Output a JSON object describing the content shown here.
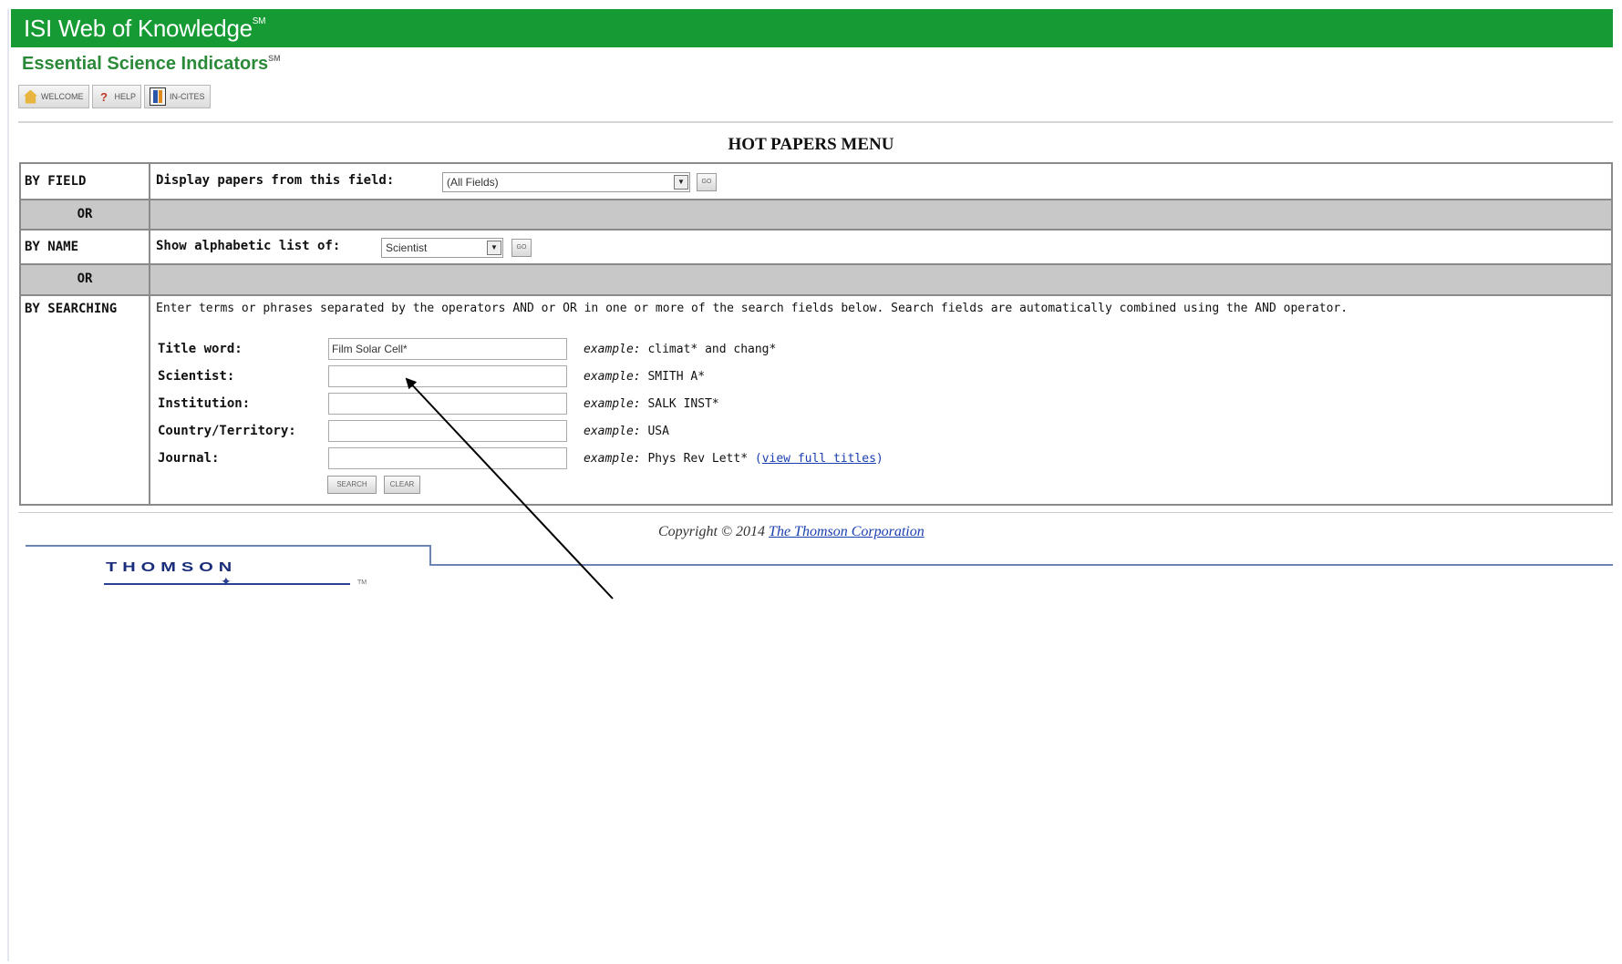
{
  "header": {
    "brand": "ISI Web of Knowledge",
    "brand_mark": "SM",
    "subtitle": "Essential Science Indicators",
    "subtitle_mark": "SM",
    "brand_color": "#159a34"
  },
  "toolbar": {
    "welcome": "WELCOME",
    "help": "HELP",
    "incites": "IN-CITES"
  },
  "menu_title": "HOT PAPERS MENU",
  "by_field": {
    "label": "BY FIELD",
    "prompt": "Display papers from this field:",
    "select_value": "(All Fields)",
    "go": "GO"
  },
  "or_label": "OR",
  "by_name": {
    "label": "BY NAME",
    "prompt": "Show alphabetic list of:",
    "select_value": "Scientist",
    "go": "GO"
  },
  "by_searching": {
    "label": "BY SEARCHING",
    "instructions": "Enter terms or phrases separated by the operators AND or OR in one or more of the search fields below. Search fields are automatically combined using the AND operator.",
    "example_prefix": "example:",
    "fields": [
      {
        "label": "Title word:",
        "value": "Film Solar Cell*",
        "example": "climat* and chang*"
      },
      {
        "label": "Scientist:",
        "value": "",
        "example": "SMITH A*"
      },
      {
        "label": "Institution:",
        "value": "",
        "example": "SALK INST*"
      },
      {
        "label": "Country/Territory:",
        "value": "",
        "example": "USA"
      },
      {
        "label": "Journal:",
        "value": "",
        "example": "Phys Rev Lett*"
      }
    ],
    "journal_link_open": "(",
    "journal_link": "view full titles",
    "journal_link_close": ")",
    "search_button": "SEARCH",
    "clear_button": "CLEAR"
  },
  "footer": {
    "copyright": "Copyright © 2014",
    "company_link": "The Thomson Corporation",
    "logo_text": "THOMSON",
    "logo_mark": "TM"
  }
}
